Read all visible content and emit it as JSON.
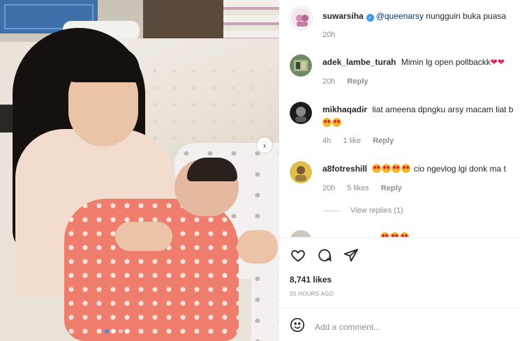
{
  "post": {
    "caption": {
      "username": "suwarsiha",
      "mention": "@queenarsy",
      "text": "nungguin buka puasa",
      "time": "20h"
    },
    "comments": [
      {
        "username": "adek_lambe_turah",
        "text": "Mimin lg open pollbackk",
        "time": "20h",
        "likes": "",
        "reply": "Reply"
      },
      {
        "username": "mikhaqadir",
        "text": "liat ameena dpngku arsy macam liat b",
        "time": "4h",
        "likes": "1 like",
        "reply": "Reply"
      },
      {
        "username": "a8fotreshill",
        "text": "cio ngevlog lgi donk ma t",
        "time": "20h",
        "likes": "5 likes",
        "reply": "Reply"
      }
    ],
    "view_replies": "View replies (1)",
    "likes_count": "8,741 likes",
    "timestamp": "20 HOURS AGO",
    "add_comment_placeholder": "Add a comment...",
    "carousel": {
      "total": 4,
      "active": 0
    }
  },
  "icons": {
    "like": "heart-icon",
    "comment": "comment-icon",
    "share": "send-icon",
    "emoji": "emoji-icon",
    "next": "chevron-right-icon"
  },
  "colors": {
    "text": "#262626",
    "muted": "#8e8e8e",
    "link": "#00376b",
    "verified": "#3897f0",
    "carousel_active": "#3b8fe3"
  }
}
